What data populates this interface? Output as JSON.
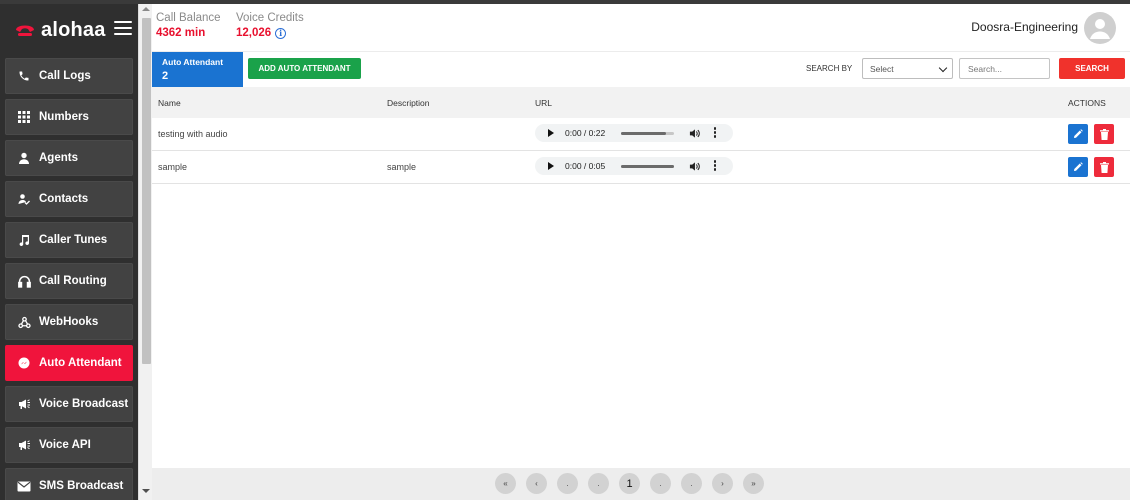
{
  "brand": {
    "name": "alohaa"
  },
  "sidebar": {
    "items": [
      {
        "label": "Call Logs",
        "icon": "phone-icon"
      },
      {
        "label": "Numbers",
        "icon": "grid-icon"
      },
      {
        "label": "Agents",
        "icon": "person-icon"
      },
      {
        "label": "Contacts",
        "icon": "contacts-icon"
      },
      {
        "label": "Caller Tunes",
        "icon": "music-note-icon"
      },
      {
        "label": "Call Routing",
        "icon": "headset-icon"
      },
      {
        "label": "WebHooks",
        "icon": "webhook-icon"
      },
      {
        "label": "Auto Attendant",
        "icon": "messenger-icon",
        "active": true
      },
      {
        "label": "Voice Broadcast",
        "icon": "megaphone-icon"
      },
      {
        "label": "Voice API",
        "icon": "megaphone-icon"
      },
      {
        "label": "SMS Broadcast",
        "icon": "envelope-icon"
      }
    ]
  },
  "header": {
    "call_balance_label": "Call Balance",
    "call_balance_value": "4362 min",
    "voice_credits_label": "Voice Credits",
    "voice_credits_value": "12,026",
    "info_glyph": "i",
    "user_name": "Doosra-Engineering"
  },
  "toolbar": {
    "count_label": "Auto Attendant",
    "count_value": "2",
    "add_button": "ADD AUTO ATTENDANT",
    "search_by_label": "SEARCH BY",
    "select_value": "Select",
    "search_placeholder": "Search...",
    "search_button": "SEARCH"
  },
  "table": {
    "columns": [
      "Name",
      "Description",
      "URL",
      "ACTIONS"
    ],
    "rows": [
      {
        "name": "testing with audio",
        "description": "",
        "audio_time": "0:00 / 0:22",
        "volume_level": 0.85
      },
      {
        "name": "sample",
        "description": "sample",
        "audio_time": "0:00 / 0:05",
        "volume_level": 1.0
      }
    ]
  },
  "pagination": {
    "buttons": [
      "«",
      "‹",
      ".",
      ".",
      "1",
      ".",
      ".",
      "›",
      "»"
    ],
    "current": "1"
  },
  "colors": {
    "brand_red": "#f0143c",
    "primary_blue": "#1a73d1",
    "success_green": "#1aa24a",
    "danger_red": "#ee2b3b"
  }
}
